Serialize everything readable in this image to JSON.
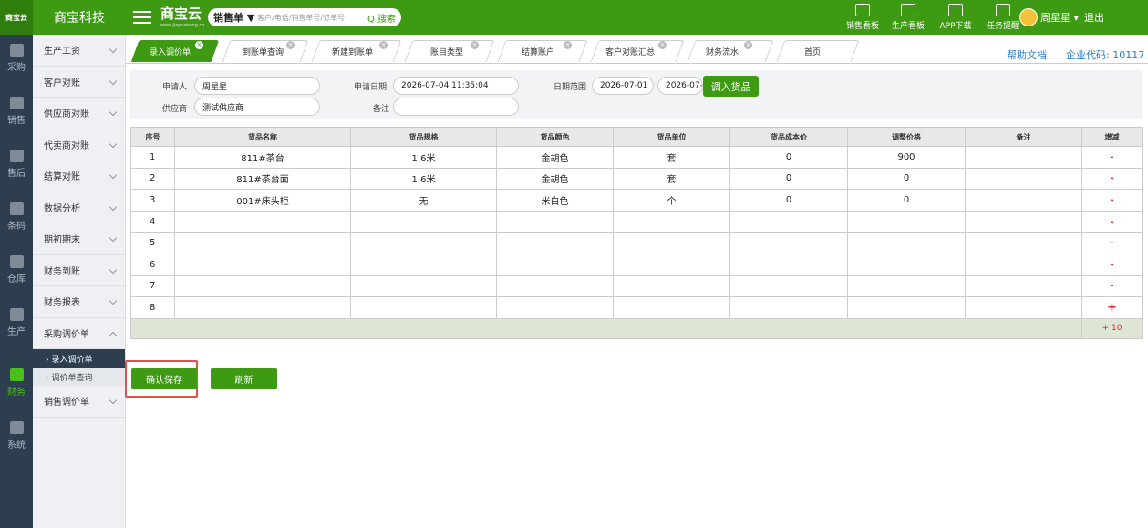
{
  "app": {
    "logo_text": "商宝云",
    "company_name": "商宝科技",
    "product_name": "商宝云",
    "product_url": "www.jiapushong.cn"
  },
  "search": {
    "selector_label": "销售单 ▼",
    "placeholder": "客户/电话/销售单号/订单号",
    "button_label": "Q 搜索"
  },
  "top_nav": [
    {
      "label": "销售看板",
      "icon": "chart-board-icon"
    },
    {
      "label": "生产看板",
      "icon": "chart-board-icon"
    },
    {
      "label": "APP下载",
      "icon": "qrcode-icon"
    },
    {
      "label": "任务提醒",
      "icon": "flag-icon"
    }
  ],
  "user": {
    "name": "周星星 ▾",
    "logout": "退出"
  },
  "rail": [
    {
      "label": "采购",
      "icon": "cart-icon"
    },
    {
      "label": "销售",
      "icon": "store-icon"
    },
    {
      "label": "售后",
      "icon": "service-icon"
    },
    {
      "label": "条码",
      "icon": "barcode-icon"
    },
    {
      "label": "仓库",
      "icon": "warehouse-icon"
    },
    {
      "label": "生产",
      "icon": "production-icon"
    },
    {
      "label": "财务",
      "icon": "calculator-icon"
    },
    {
      "label": "系统",
      "icon": "gear-icon"
    }
  ],
  "submenu": {
    "items": [
      "生产工资",
      "客户对账",
      "供应商对账",
      "代卖商对账",
      "结算对账",
      "数据分析",
      "期初期末",
      "财务到账",
      "财务报表",
      "采购调价单"
    ],
    "expanded_children": [
      "› 录入调价单",
      "› 调价单查询"
    ],
    "after": [
      "销售调价单"
    ]
  },
  "tabs": [
    {
      "label": "录入调价单",
      "active": true
    },
    {
      "label": "到账单查询",
      "active": false
    },
    {
      "label": "新建到账单",
      "active": false
    },
    {
      "label": "账目类型",
      "active": false
    },
    {
      "label": "结算账户",
      "active": false
    },
    {
      "label": "客户对账汇总",
      "active": false
    },
    {
      "label": "财务流水",
      "active": false
    },
    {
      "label": "首页",
      "active": false
    }
  ],
  "header_links": {
    "help": "帮助文档",
    "corp_code": "企业代码: 10117"
  },
  "form": {
    "applicant_label": "申请人",
    "applicant_value": "周星星",
    "date_label": "申请日期",
    "date_value": "2026-07-04 11:35:04",
    "range_label": "日期范围",
    "range_start": "2026-07-01",
    "range_end": "2026-07-0",
    "supplier_label": "供应商",
    "supplier_value": "测试供应商",
    "remark_label": "备注",
    "remark_value": "",
    "import_button": "调入货品"
  },
  "table": {
    "headers": [
      "序号",
      "货品名称",
      "货品规格",
      "货品颜色",
      "货品单位",
      "货品成本价",
      "调整价格",
      "备注",
      "增减"
    ],
    "rows": [
      [
        "1",
        "811#茶台",
        "1.6米",
        "金胡色",
        "套",
        "0",
        "900",
        "",
        "-"
      ],
      [
        "2",
        "811#茶台面",
        "1.6米",
        "金胡色",
        "套",
        "0",
        "0",
        "",
        "-"
      ],
      [
        "3",
        "001#床头柜",
        "无",
        "米白色",
        "个",
        "0",
        "0",
        "",
        "-"
      ],
      [
        "4",
        "",
        "",
        "",
        "",
        "",
        "",
        "",
        "-"
      ],
      [
        "5",
        "",
        "",
        "",
        "",
        "",
        "",
        "",
        "-"
      ],
      [
        "6",
        "",
        "",
        "",
        "",
        "",
        "",
        "",
        "-"
      ],
      [
        "7",
        "",
        "",
        "",
        "",
        "",
        "",
        "",
        "-"
      ],
      [
        "8",
        "",
        "",
        "",
        "",
        "",
        "",
        "",
        "+"
      ]
    ],
    "footer_action": "+ 10"
  },
  "actions": {
    "save": "确认保存",
    "refresh": "刷新"
  },
  "colors": {
    "brand_green": "#3d9a12",
    "sidebar_dark": "#2c3e50",
    "danger": "#e23",
    "highlight_box": "#e0504f"
  }
}
